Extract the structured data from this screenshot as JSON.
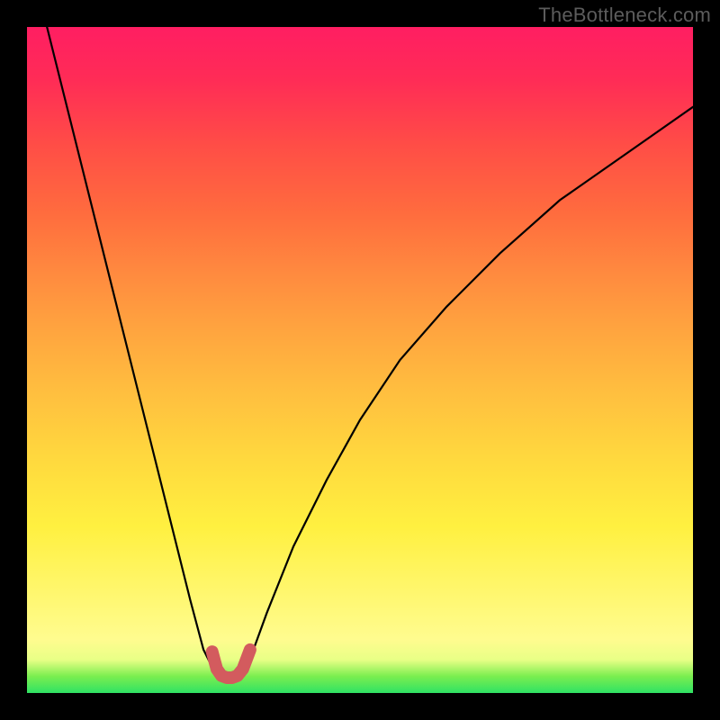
{
  "watermark": "TheBottleneck.com",
  "chart_data": {
    "type": "line",
    "title": "",
    "xlabel": "",
    "ylabel": "",
    "xlim": [
      0,
      100
    ],
    "ylim": [
      0,
      100
    ],
    "series": [
      {
        "name": "bottleneck-curve",
        "x": [
          3,
          8,
          14,
          18,
          22,
          24.5,
          26.5,
          28,
          29,
          30,
          31,
          32,
          33,
          34,
          36,
          40,
          45,
          50,
          56,
          63,
          71,
          80,
          90,
          100
        ],
        "y": [
          100,
          80,
          56,
          40,
          24,
          14,
          6.5,
          3.5,
          2.6,
          2.3,
          2.3,
          2.6,
          3.5,
          6.5,
          12,
          22,
          32,
          41,
          50,
          58,
          66,
          74,
          81,
          88
        ]
      },
      {
        "name": "optimal-band",
        "x": [
          27.8,
          28.5,
          29.2,
          30.0,
          30.8,
          31.6,
          32.4,
          33.5
        ],
        "y": [
          6.2,
          3.6,
          2.6,
          2.3,
          2.3,
          2.6,
          3.6,
          6.5
        ]
      }
    ],
    "colors": {
      "curve": "#000000",
      "band": "#d35b5e"
    }
  }
}
